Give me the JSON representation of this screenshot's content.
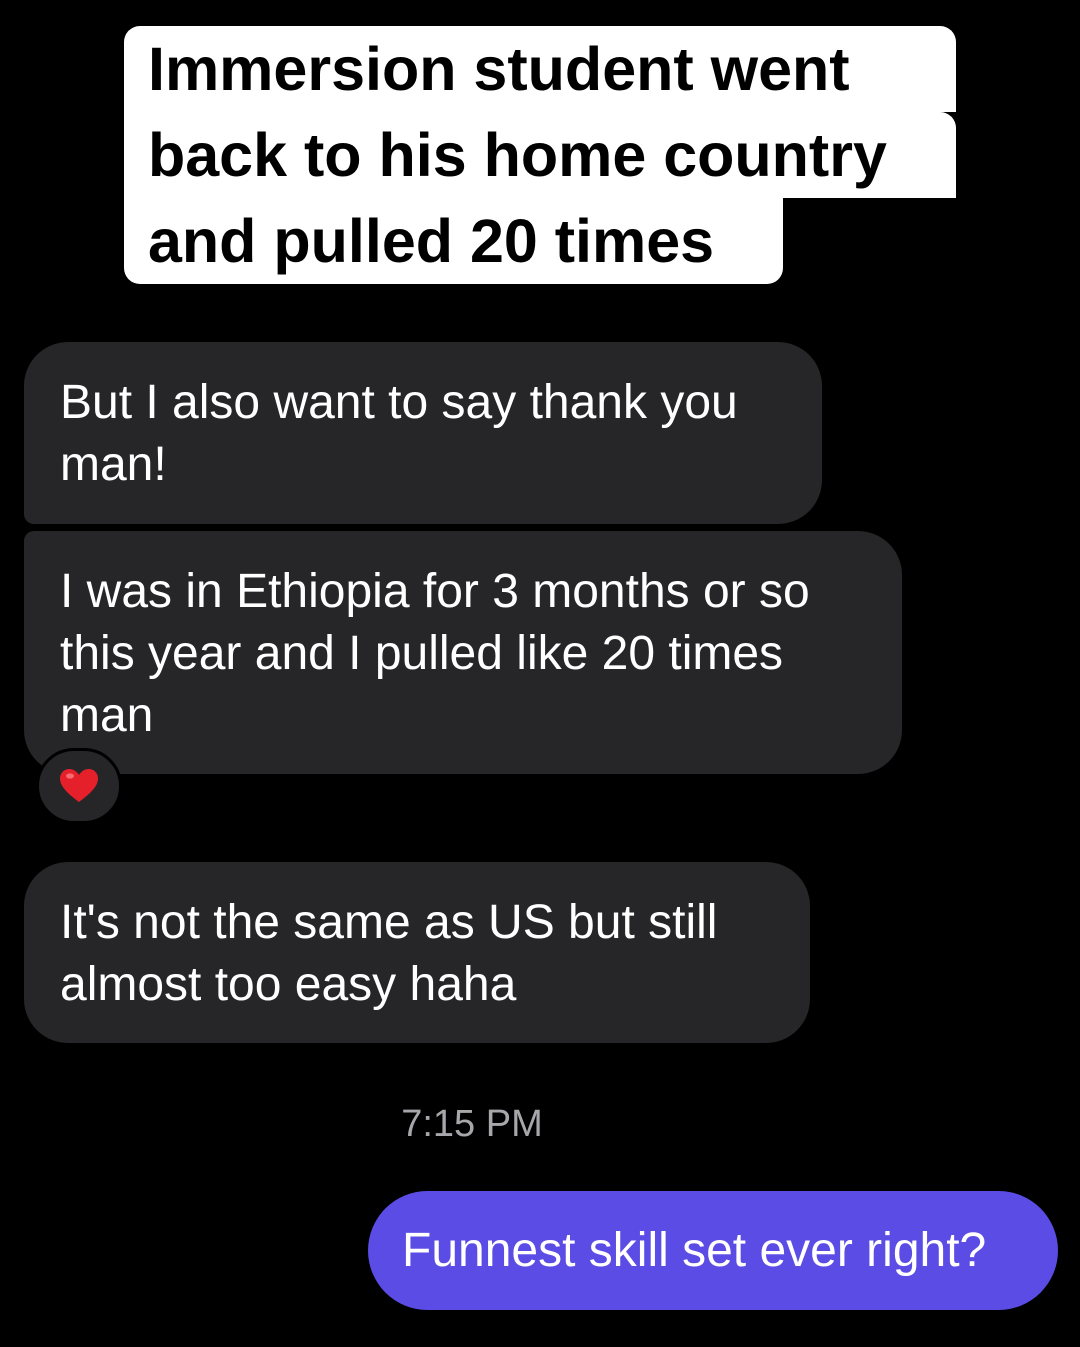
{
  "caption": {
    "lines": [
      "Immersion student went",
      "back to his home country",
      "and pulled 20 times"
    ]
  },
  "conversation": {
    "incoming": [
      {
        "lines": [
          "But I also want to say thank you",
          "man!"
        ]
      },
      {
        "lines": [
          "I was in Ethiopia for 3 months or so",
          "this year and I pulled like 20 times",
          "man"
        ],
        "reaction": "heart-icon"
      },
      {
        "lines": [
          "It's not the same as US but still",
          "almost too easy haha"
        ]
      }
    ],
    "timestamp": "7:15 PM",
    "outgoing": [
      {
        "text": "Funnest skill set ever right?"
      }
    ]
  },
  "colors": {
    "background": "#000000",
    "incoming_bubble": "#262628",
    "outgoing_bubble": "#5b4ce5",
    "timestamp": "#a7a7ab",
    "reaction_heart": "#e5202a"
  }
}
